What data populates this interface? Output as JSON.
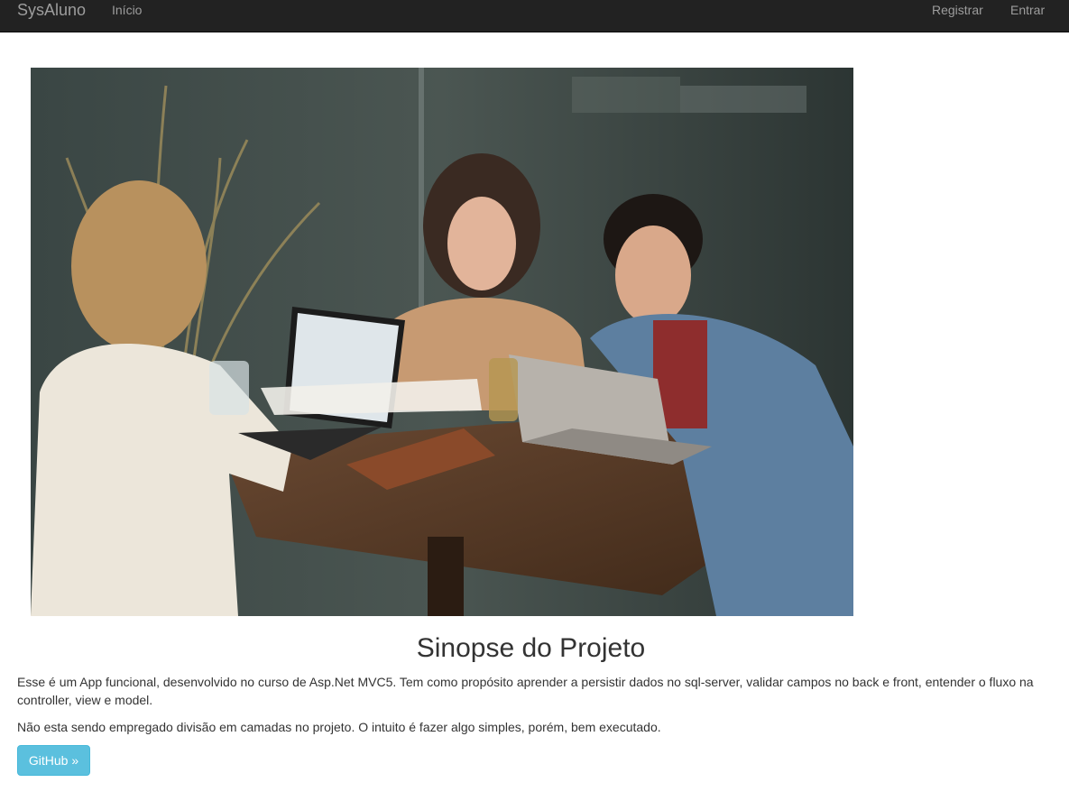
{
  "nav": {
    "brand": "SysAluno",
    "home": "Início",
    "register": "Registrar",
    "login": "Entrar"
  },
  "hero": {
    "description_icon": "photo-people-laptops"
  },
  "main": {
    "title": "Sinopse do Projeto",
    "paragraph1": "Esse é um App funcional, desenvolvido no curso de Asp.Net MVC5. Tem como propósito aprender a persistir dados no sql-server, validar campos no back e front, entender o fluxo na controller, view e model.",
    "paragraph2": "Não esta sendo empregado divisão em camadas no projeto. O intuito é fazer algo simples, porém, bem executado.",
    "button_label": "GitHub »"
  },
  "colors": {
    "navbar_bg": "#222222",
    "nav_text": "#9d9d9d",
    "button_bg": "#5bc0de",
    "text": "#333333"
  }
}
